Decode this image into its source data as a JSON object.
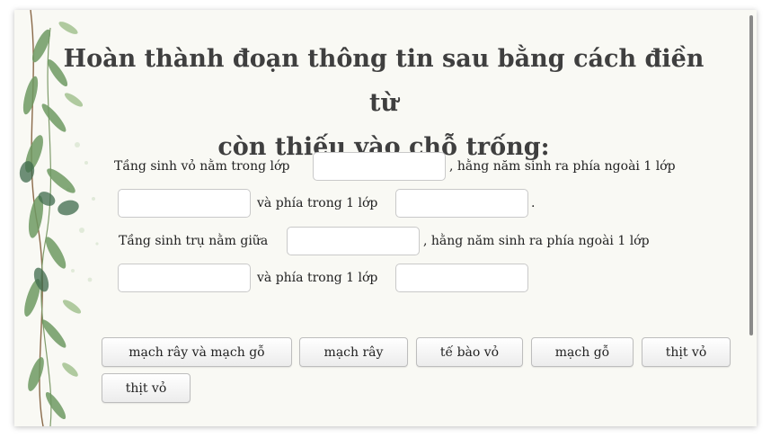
{
  "question": {
    "title_line1": "Hoàn thành đoạn thông tin sau bằng cách điền từ",
    "title_line2": "còn thiếu vào chỗ trống:"
  },
  "passage": {
    "s1_a": "Tầng sinh vỏ nằm trong lớp",
    "s1_b": ", hằng năm sinh ra phía ngoài 1 lớp",
    "s1_c": "và phía trong 1 lớp",
    "s1_end": ".",
    "s2_a": "Tầng sinh trụ nằm giữa",
    "s2_b": ", hằng năm sinh ra phía ngoài 1 lớp",
    "s2_c": "và phía trong 1 lớp"
  },
  "blanks": [
    "",
    "",
    "",
    "",
    "",
    ""
  ],
  "options": [
    "mạch rây và mạch gỗ",
    "mạch rây",
    "tế bào vỏ",
    "mạch gỗ",
    "thịt vỏ",
    "thịt vỏ"
  ]
}
